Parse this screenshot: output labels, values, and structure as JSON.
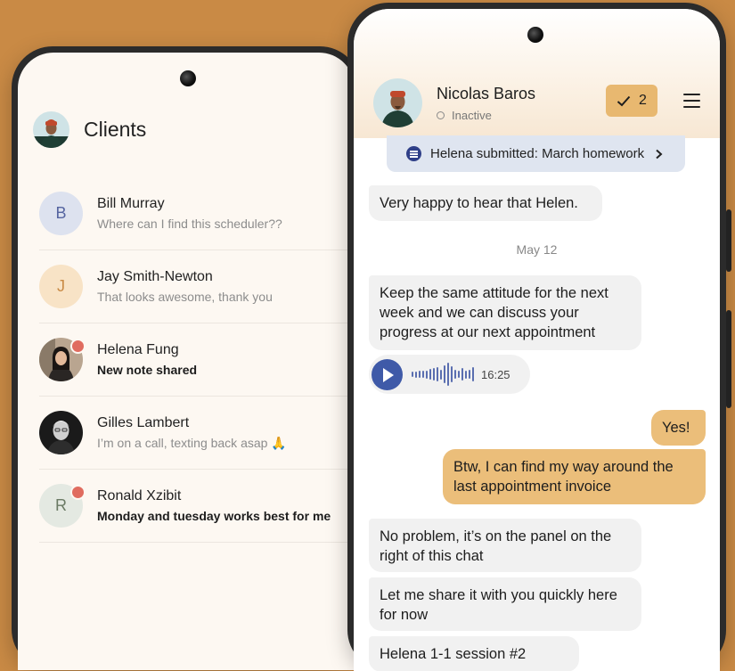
{
  "colors": {
    "background": "#c98a45",
    "accent_bubble": "#ebbe7a",
    "task_badge": "#e8b870",
    "unread_dot": "#e06c5f",
    "play_button": "#3f5aa8"
  },
  "clients_screen": {
    "title": "Clients",
    "clients": [
      {
        "name": "Bill Murray",
        "message": "Where can I find this scheduler??",
        "initial": "B",
        "unread": false,
        "bold": false
      },
      {
        "name": "Jay Smith-Newton",
        "message": "That looks awesome, thank you",
        "initial": "J",
        "unread": false,
        "bold": false
      },
      {
        "name": "Helena Fung",
        "message": "New note shared",
        "initial": "",
        "unread": true,
        "bold": true
      },
      {
        "name": "Gilles Lambert",
        "message": "I’m on a call, texting back asap 🙏",
        "initial": "",
        "unread": false,
        "bold": false
      },
      {
        "name": "Ronald Xzibit",
        "message": "Monday and tuesday works best for me",
        "initial": "R",
        "unread": true,
        "bold": true
      }
    ]
  },
  "chat_screen": {
    "contact_name": "Nicolas Baros",
    "contact_status": "Inactive",
    "task_count": "2",
    "submission_text": "Helena submitted: March homework",
    "date_separator": "May 12",
    "voice_duration": "16:25",
    "messages": [
      {
        "direction": "in",
        "text": "Very happy to hear that Helen."
      },
      {
        "direction": "in",
        "text": "Keep the same attitude for the next week and we can discuss your progress at our next appointment"
      },
      {
        "direction": "out",
        "text": "Yes!"
      },
      {
        "direction": "out",
        "text": "Btw, I can find my way around the last appointment invoice"
      },
      {
        "direction": "in",
        "text": "No problem, it’s on the panel on the right of this chat"
      },
      {
        "direction": "in",
        "text": "Let me share it with you quickly here for now"
      },
      {
        "direction": "in",
        "text": "Helena 1-1 session #2"
      }
    ]
  }
}
